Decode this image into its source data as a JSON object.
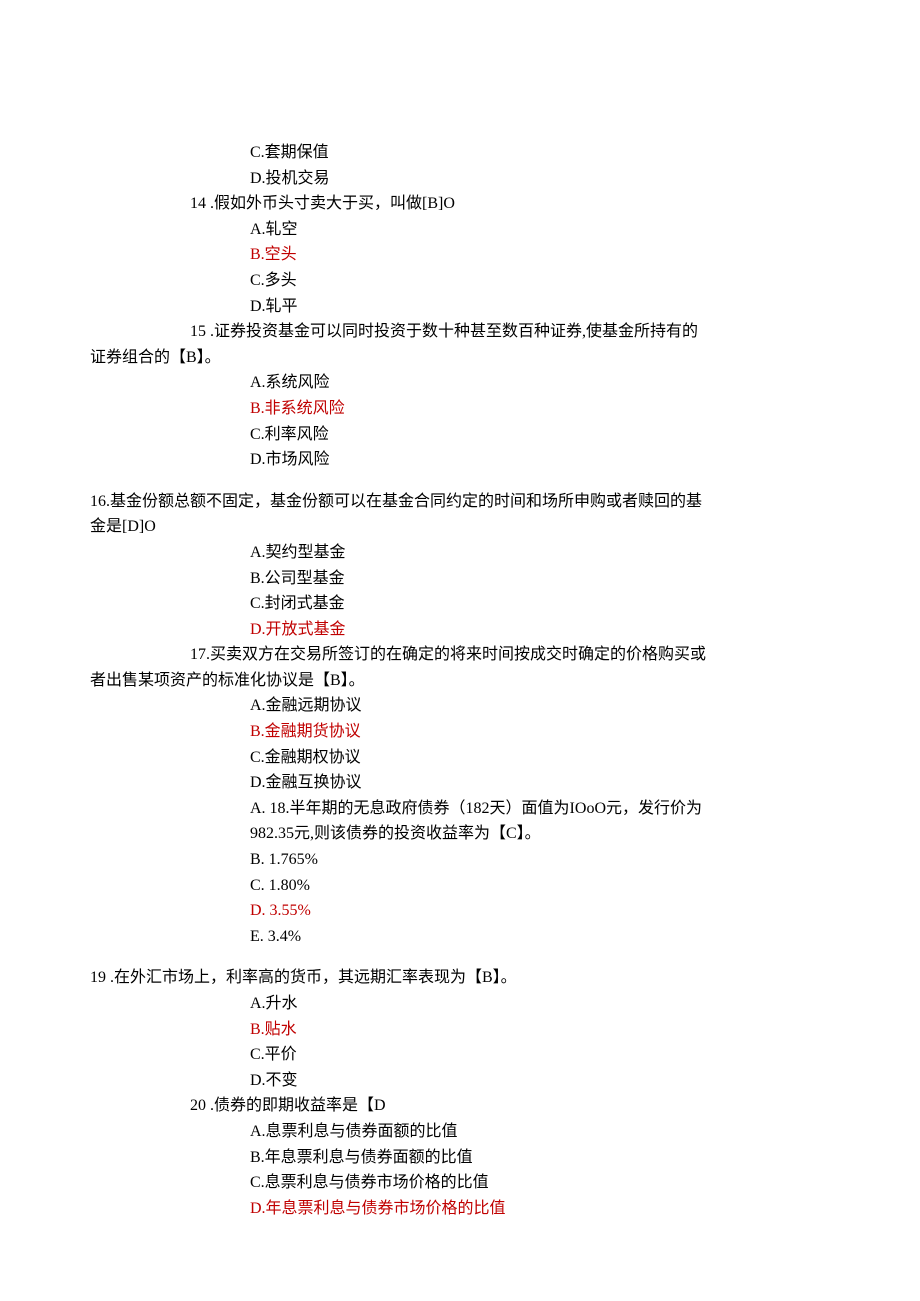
{
  "q13": {
    "optC": "C.套期保值",
    "optD": "D.投机交易"
  },
  "q14": {
    "stem": "14 .假如外币头寸卖大于买，叫做[B]O",
    "optA": "A.轧空",
    "optB": "B.空头",
    "optC": "C.多头",
    "optD": "D.轧平"
  },
  "q15": {
    "stem1": "15 .证券投资基金可以同时投资于数十种甚至数百种证券,使基金所持有的",
    "stem2": "证券组合的【B】。",
    "optA": "A.系统风险",
    "optB": "B.非系统风险",
    "optC": "C.利率风险",
    "optD": "D.市场风险"
  },
  "q16": {
    "stem1": "16.基金份额总额不固定，基金份额可以在基金合同约定的时间和场所申购或者赎回的基",
    "stem2": "金是[D]O",
    "optA": "A.契约型基金",
    "optB": "B.公司型基金",
    "optC": "C.封闭式基金",
    "optD": "D.开放式基金"
  },
  "q17": {
    "stem1": "17.买卖双方在交易所签订的在确定的将来时间按成交时确定的价格购买或",
    "stem2": "者出售某项资产的标准化协议是【B】。",
    "optA": "A.金融远期协议",
    "optB": "B.金融期货协议",
    "optC": "C.金融期权协议",
    "optD": "D.金融互换协议"
  },
  "q18": {
    "stemA": "A.  18.半年期的无息政府债券（182天）面值为IOoO元，发行价为",
    "stem2": "982.35元,则该债券的投资收益率为【C】。",
    "optB": "B.  1.765%",
    "optC": "C.  1.80%",
    "optD": "D.  3.55%",
    "optE": "E.  3.4%"
  },
  "q19": {
    "stem": "19 .在外汇市场上，利率高的货币，其远期汇率表现为【B】。",
    "optA": "A.升水",
    "optB": "B.贴水",
    "optC": "C.平价",
    "optD": "D.不变"
  },
  "q20": {
    "stem": "20 .债券的即期收益率是【D",
    "optA": "A.息票利息与债券面额的比值",
    "optB": "B.年息票利息与债券面额的比值",
    "optC": "C.息票利息与债券市场价格的比值",
    "optD": "D.年息票利息与债券市场价格的比值"
  }
}
